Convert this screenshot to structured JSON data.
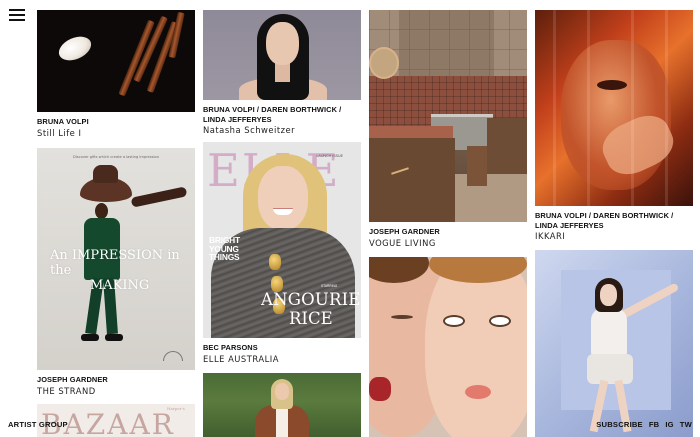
{
  "header": {
    "menu_icon": "hamburger-menu-icon"
  },
  "columns": [
    {
      "cards": [
        {
          "credit": "BRUNA VOLPI",
          "publication": "Still Life I"
        },
        {
          "credit": "JOSEPH GARDNER",
          "publication": "THE STRAND",
          "cover": {
            "tagline": "Discover gifts which create a lasting impression",
            "headline_line1": "An IMPRESSION in the",
            "headline_line2": "MAKING"
          }
        },
        {
          "cover": {
            "masthead": "BAZAAR",
            "harpers": "Harper's"
          }
        }
      ]
    },
    {
      "cards": [
        {
          "credit": "BRUNA VOLPI / DAREN BORTHWICK / LINDA JEFFERYES",
          "publication": "Natasha Schweitzer"
        },
        {
          "credit": "BEC PARSONS",
          "publication": "ELLE AUSTRALIA",
          "cover": {
            "masthead": "ELLE",
            "launch": "LAUNCH ISSUE",
            "coverline": "BRIGHT YOUNG THINGS",
            "starring": "STARRING",
            "name_first": "ANGOURIE",
            "name_last": "RICE"
          }
        },
        {}
      ]
    },
    {
      "cards": [
        {
          "credit": "JOSEPH GARDNER",
          "publication": "VOGUE LIVING"
        },
        {}
      ]
    },
    {
      "cards": [
        {
          "credit": "BRUNA VOLPI / DAREN BORTHWICK / LINDA JEFFERYES",
          "publication": "IKKARI"
        },
        {}
      ]
    }
  ],
  "footer": {
    "brand": "ARTIST GROUP",
    "subscribe": "SUBSCRIBE",
    "social": [
      "FB",
      "IG",
      "TW"
    ]
  },
  "colors": {
    "background": "#ffffff",
    "text": "#111111"
  }
}
